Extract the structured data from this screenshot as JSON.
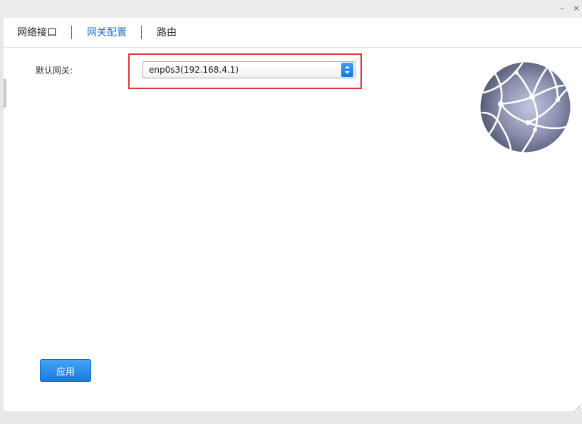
{
  "window": {
    "controls": {
      "minimize": "–",
      "close": "×"
    }
  },
  "tabs": [
    {
      "label": "网络接口",
      "active": false
    },
    {
      "label": "网关配置",
      "active": true
    },
    {
      "label": "路由",
      "active": false
    }
  ],
  "gateway": {
    "label": "默认网关:",
    "selected": "enp0s3(192.168.4.1)"
  },
  "actions": {
    "apply_label": "应用"
  },
  "colors": {
    "accent": "#1e73c9",
    "button": "#2a8ae6",
    "highlight": "#e0363a"
  },
  "icons": {
    "logo": "network-globe-icon",
    "select_arrow": "up-down-arrow-icon"
  }
}
